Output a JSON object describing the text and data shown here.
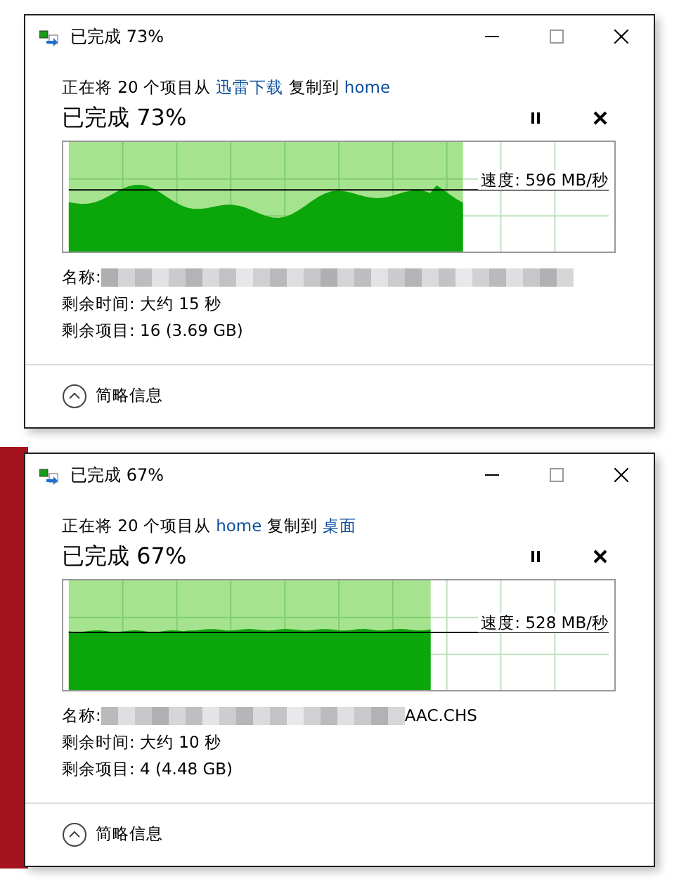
{
  "dialogs": [
    {
      "title": "已完成 73%",
      "description": {
        "prefix": "正在将 20 个项目从",
        "source": "迅雷下载",
        "middle": "复制到",
        "destination": "home"
      },
      "progress_text": "已完成 73%",
      "level": 0.73,
      "speed": "速度: 596 MB/秒",
      "name_label": "名称:",
      "time_remaining": "剩余时间: 大约 15 秒",
      "items_remaining": "剩余项目: 16 (3.69 GB)",
      "details_toggle": "简略信息"
    },
    {
      "title": "已完成 67%",
      "description": {
        "prefix": "正在将 20 个项目从",
        "source": "home",
        "middle": "复制到",
        "destination": "桌面"
      },
      "progress_text": "已完成 67%",
      "level": 0.67,
      "speed": "速度: 528 MB/秒",
      "name_label": "名称:",
      "name_value": "AAC.CHS",
      "time_remaining": "剩余时间: 大约 10 秒",
      "items_remaining": "剩余项目: 4 (4.48 GB)",
      "details_toggle": "简略信息"
    }
  ]
}
